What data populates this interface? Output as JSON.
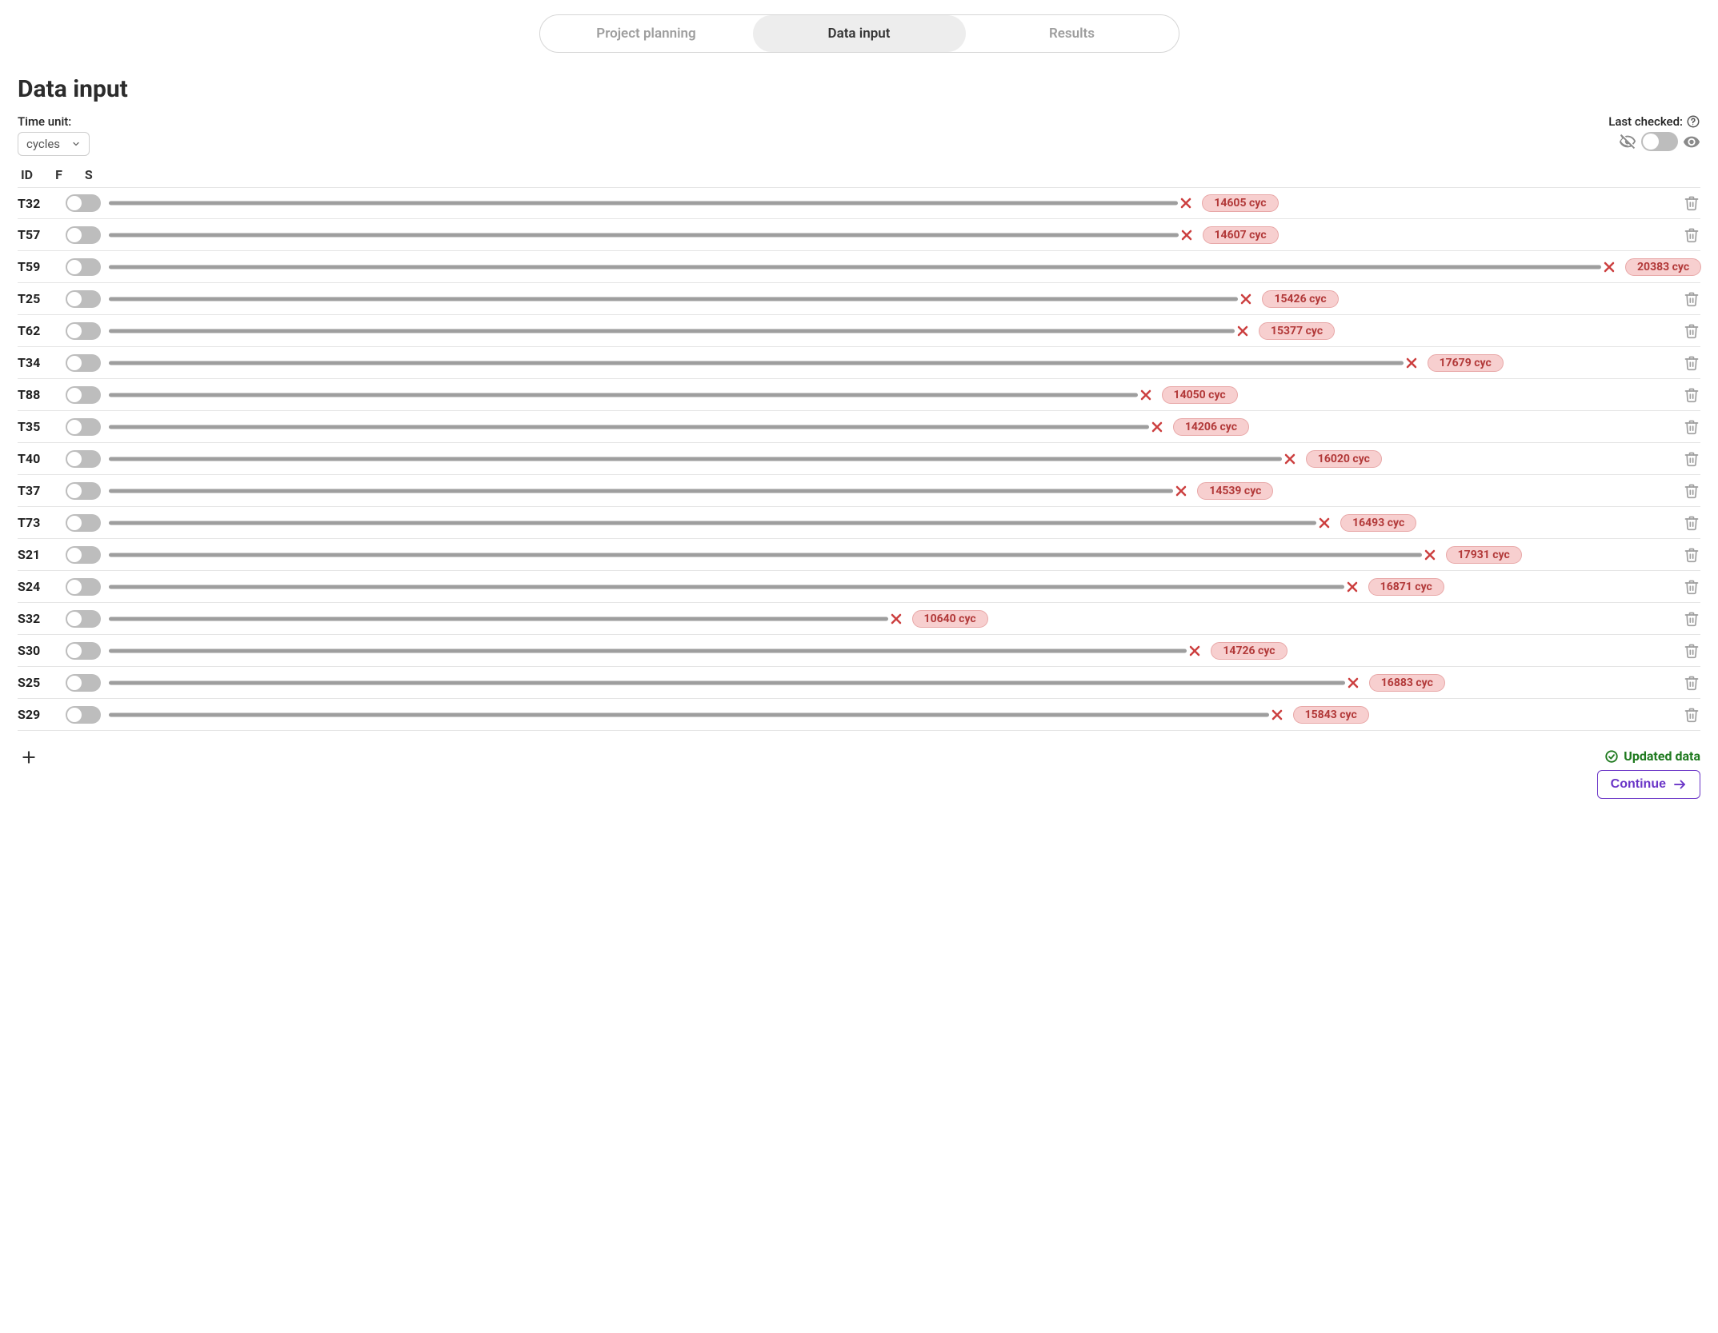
{
  "tabs": {
    "items": [
      {
        "label": "Project planning",
        "active": false
      },
      {
        "label": "Data input",
        "active": true
      },
      {
        "label": "Results",
        "active": false
      }
    ]
  },
  "page_title": "Data input",
  "time_unit": {
    "label": "Time unit:",
    "value": "cycles"
  },
  "last_checked": {
    "label": "Last checked:"
  },
  "columns": {
    "id": "ID",
    "f": "F",
    "s": "S"
  },
  "unit_suffix": "cyc",
  "max_value": 20383,
  "rows": [
    {
      "id": "T32",
      "value": 14605
    },
    {
      "id": "T57",
      "value": 14607
    },
    {
      "id": "T59",
      "value": 20383
    },
    {
      "id": "T25",
      "value": 15426
    },
    {
      "id": "T62",
      "value": 15377
    },
    {
      "id": "T34",
      "value": 17679
    },
    {
      "id": "T88",
      "value": 14050
    },
    {
      "id": "T35",
      "value": 14206
    },
    {
      "id": "T40",
      "value": 16020
    },
    {
      "id": "T37",
      "value": 14539
    },
    {
      "id": "T73",
      "value": 16493
    },
    {
      "id": "S21",
      "value": 17931
    },
    {
      "id": "S24",
      "value": 16871
    },
    {
      "id": "S32",
      "value": 10640
    },
    {
      "id": "S30",
      "value": 14726
    },
    {
      "id": "S25",
      "value": 16883
    },
    {
      "id": "S29",
      "value": 15843
    }
  ],
  "footer": {
    "updated_label": "Updated data",
    "continue_label": "Continue"
  }
}
